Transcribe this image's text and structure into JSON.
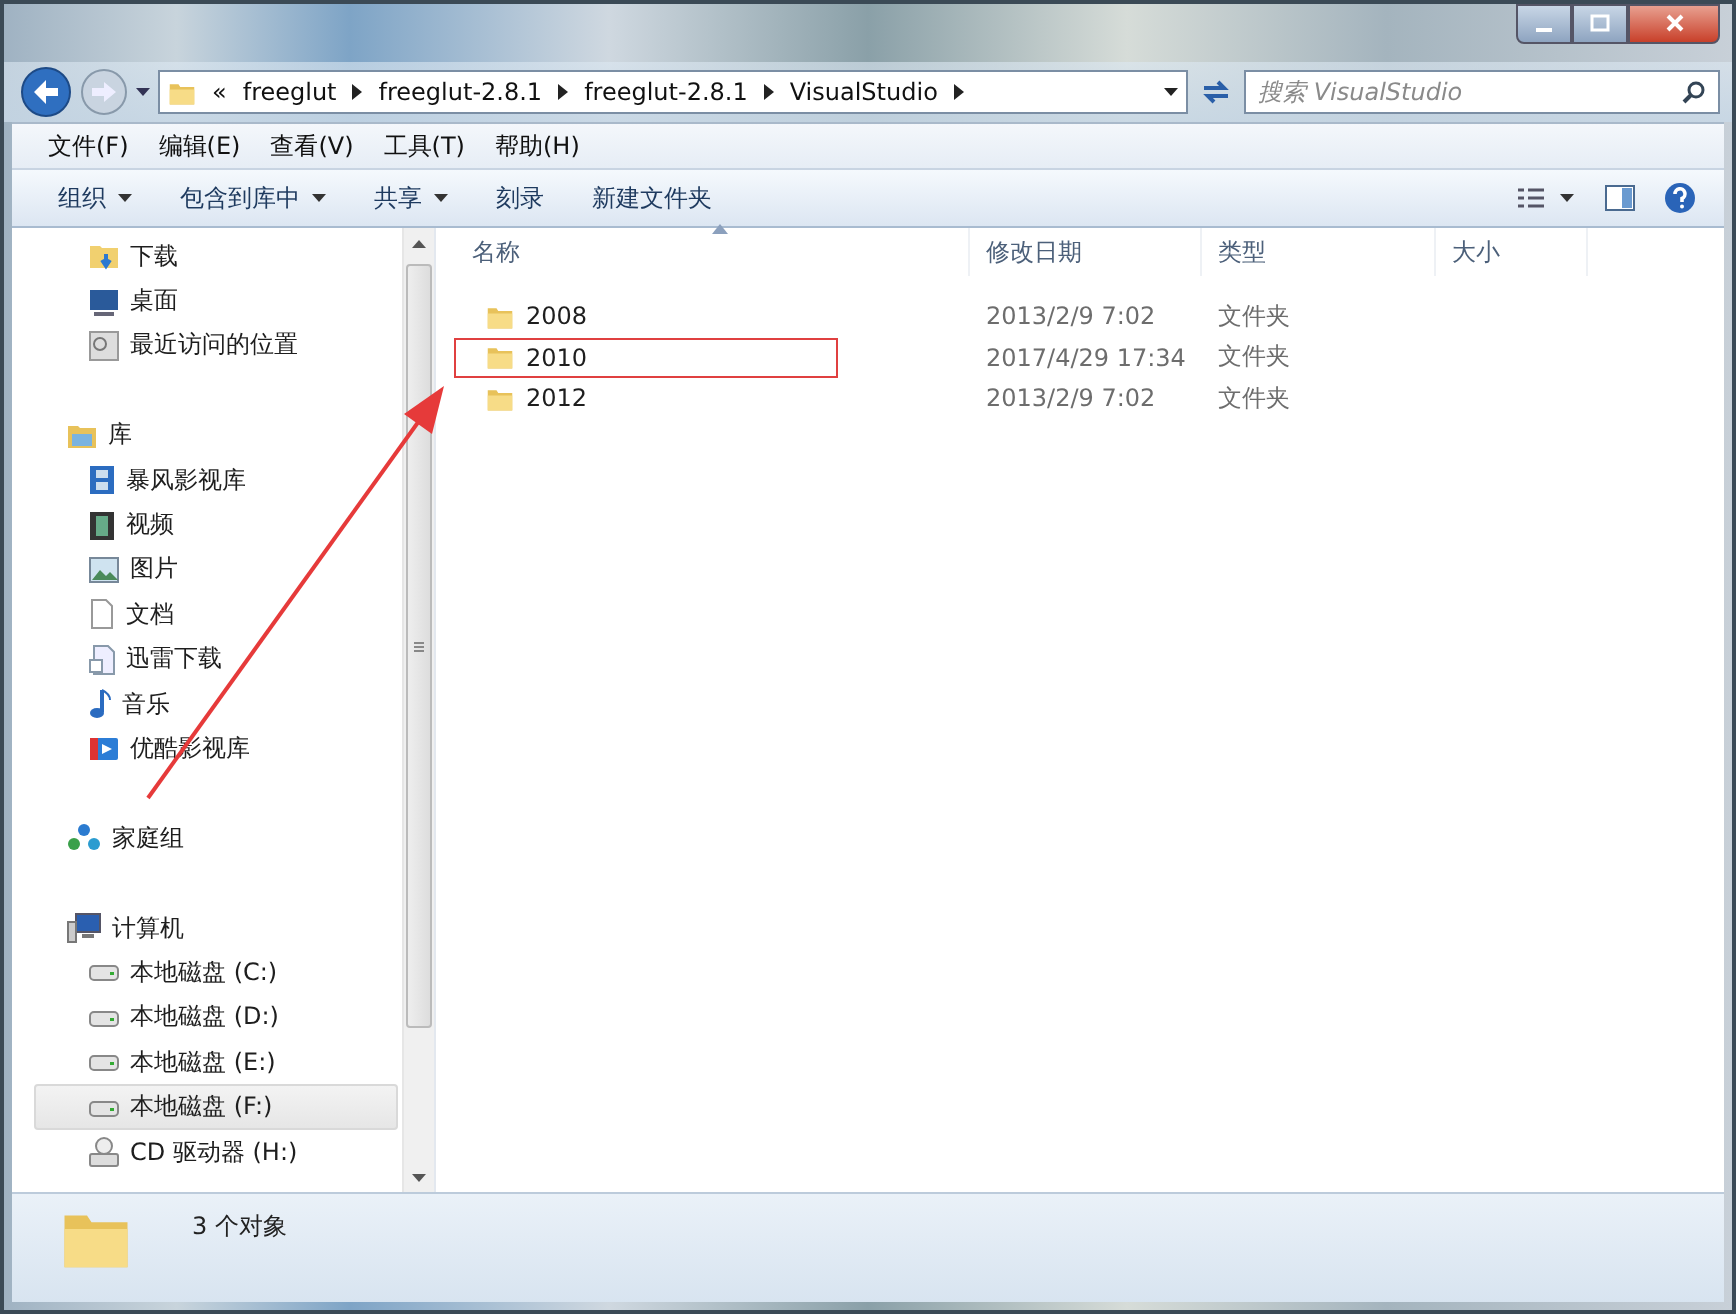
{
  "window": {
    "controls": [
      {
        "kind": "minimize"
      },
      {
        "kind": "maximize"
      },
      {
        "kind": "close"
      }
    ]
  },
  "address": {
    "overflow": "«",
    "crumbs": [
      "freeglut",
      "freeglut-2.8.1",
      "freeglut-2.8.1",
      "VisualStudio"
    ]
  },
  "search": {
    "placeholder": "搜索 VisualStudio"
  },
  "menu": [
    "文件(F)",
    "编辑(E)",
    "查看(V)",
    "工具(T)",
    "帮助(H)"
  ],
  "toolbar": [
    {
      "label": "组织",
      "dropdown": true
    },
    {
      "label": "包含到库中",
      "dropdown": true
    },
    {
      "label": "共享",
      "dropdown": true
    },
    {
      "label": "刻录",
      "dropdown": false
    },
    {
      "label": "新建文件夹",
      "dropdown": false
    }
  ],
  "sidebar": {
    "groups": [
      {
        "children": [
          {
            "label": "下载",
            "selected": false
          },
          {
            "label": "桌面",
            "selected": false
          },
          {
            "label": "最近访问的位置",
            "selected": false
          }
        ]
      },
      {
        "label": "库",
        "children": [
          {
            "label": "暴风影视库",
            "selected": false
          },
          {
            "label": "视频",
            "selected": false
          },
          {
            "label": "图片",
            "selected": false
          },
          {
            "label": "文档",
            "selected": false
          },
          {
            "label": "迅雷下载",
            "selected": false
          },
          {
            "label": "音乐",
            "selected": false
          },
          {
            "label": "优酷影视库",
            "selected": false
          }
        ]
      },
      {
        "label": "家庭组"
      },
      {
        "label": "计算机",
        "children": [
          {
            "label": "本地磁盘 (C:)",
            "selected": false
          },
          {
            "label": "本地磁盘 (D:)",
            "selected": false
          },
          {
            "label": "本地磁盘 (E:)",
            "selected": false
          },
          {
            "label": "本地磁盘 (F:)",
            "selected": true
          },
          {
            "label": "CD 驱动器 (H:)",
            "selected": false
          }
        ]
      }
    ]
  },
  "table": {
    "columns": [
      "名称",
      "修改日期",
      "类型",
      "大小"
    ],
    "rows": [
      {
        "name": "2008",
        "modified": "2013/2/9 7:02",
        "type": "文件夹",
        "highlighted": false
      },
      {
        "name": "2010",
        "modified": "2017/4/29 17:34",
        "type": "文件夹",
        "highlighted": true
      },
      {
        "name": "2012",
        "modified": "2013/2/9 7:02",
        "type": "文件夹",
        "highlighted": false
      }
    ]
  },
  "status_bar": {
    "count": "3 个对象"
  }
}
